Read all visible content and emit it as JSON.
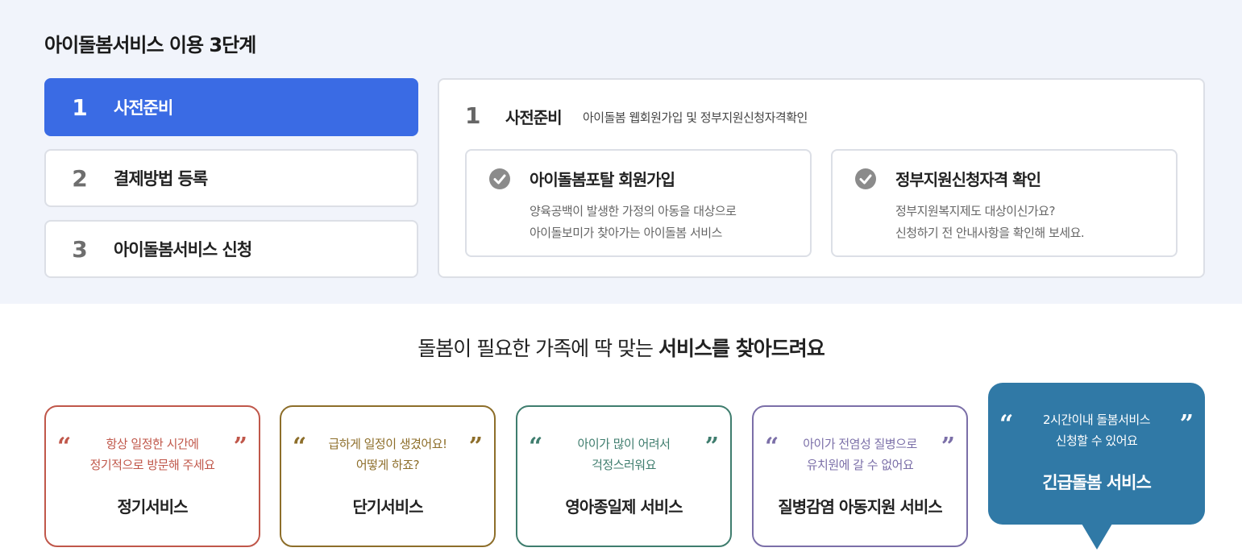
{
  "steps_section": {
    "title": "아이돌봄서비스 이용 3단계",
    "steps": [
      {
        "num": "1",
        "label": "사전준비"
      },
      {
        "num": "2",
        "label": "결제방법 등록"
      },
      {
        "num": "3",
        "label": "아이돌봄서비스 신청"
      }
    ],
    "detail": {
      "num": "1",
      "title": "사전준비",
      "description": "아이돌봄 웹회원가입 및 정부지원신청자격확인",
      "cards": [
        {
          "icon": "check-circle-icon",
          "title": "아이돌봄포탈 회원가입",
          "lines": [
            "양육공백이 발생한 가정의 아동을 대상으로",
            "아이돌보미가 찾아가는 아이돌봄 서비스"
          ]
        },
        {
          "icon": "check-circle-icon",
          "title": "정부지원신청자격 확인",
          "lines": [
            "정부지원복지제도 대상이신가요?",
            "신청하기 전 안내사항을 확인해 보세요."
          ]
        }
      ]
    }
  },
  "services_section": {
    "heading_normal": "돌봄이 필요한 가족에 딱 맞는 ",
    "heading_bold": "서비스를 찾아드려요",
    "quote_open": "“",
    "quote_close": "”",
    "services": [
      {
        "lines": [
          "항상 일정한 시간에",
          "정기적으로 방문해 주세요"
        ],
        "name": "정기서비스",
        "color": "#c0574a"
      },
      {
        "lines": [
          "급하게 일정이 생겼어요!",
          "어떻게 하죠?"
        ],
        "name": "단기서비스",
        "color": "#8d6e2a"
      },
      {
        "lines": [
          "아이가 많이 어려서",
          "걱정스러워요"
        ],
        "name": "영아종일제 서비스",
        "color": "#3f7d6e"
      },
      {
        "lines": [
          "아이가 전염성 질병으로",
          "유치원에 갈 수 없어요"
        ],
        "name": "질병감염 아동지원 서비스",
        "color": "#7b6fa8"
      },
      {
        "lines": [
          "2시간이내 돌봄서비스",
          "신청할 수 있어요"
        ],
        "name": "긴급돌봄 서비스",
        "color": "#3079a6"
      }
    ]
  },
  "colors": {
    "accent": "#3a6be4",
    "background_top": "#f1f4fb",
    "featured": "#3079a6"
  }
}
